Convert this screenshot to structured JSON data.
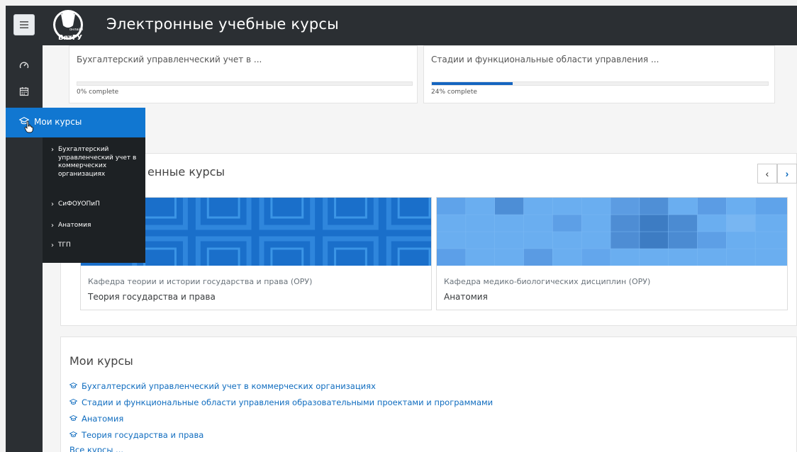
{
  "header": {
    "site_title": "Электронные учебные курсы",
    "logo_text": "ВятГУ",
    "logo_subtext": "онлайн"
  },
  "icons": {
    "menu": "hamburger-icon",
    "dashboard": "dashboard-gauge-icon",
    "calendar": "calendar-icon",
    "course": "graduation-cap-icon"
  },
  "colors": {
    "navbar": "#2b2f33",
    "accent": "#1177d1",
    "link": "#0f6cbf",
    "progress": "#1565c0",
    "flyout": "#1d2124"
  },
  "progress_courses": [
    {
      "title": "Бухгалтерский управленческий учет в ...",
      "progress_text": "0% complete",
      "progress": 0
    },
    {
      "title": "Стадии и функциональные области управления ...",
      "progress_text": "24% complete",
      "progress": 24
    }
  ],
  "starred": {
    "title_visible": "енные курсы",
    "prev_label": "‹",
    "next_label": "›",
    "courses": [
      {
        "category": "Кафедра теории и истории государства и права (ОРУ)",
        "name": "Теория государства и права"
      },
      {
        "category": "Кафедра медико-биологических дисциплин (ОРУ)",
        "name": "Анатомия"
      }
    ]
  },
  "my_courses_block": {
    "title": "Мои курсы",
    "courses": [
      "Бухгалтерский управленческий учет в коммерческих организациях",
      "Стадии и функциональные области управления образовательными проектами и программами",
      "Анатомия",
      "Теория государства и права"
    ],
    "all_courses_label": "Все курсы ..."
  },
  "flyout": {
    "label": "Мои курсы",
    "items": [
      "Бухгалтерский управленческий учет в коммерческих организациях",
      "СиФОУОПиП",
      "Анатомия",
      "ТГП"
    ]
  }
}
